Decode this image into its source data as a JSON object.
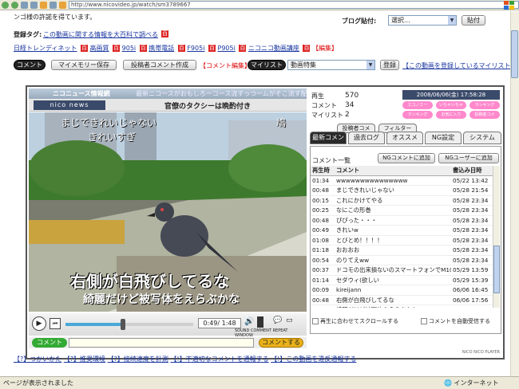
{
  "browser": {
    "address": "http://www.nicovideo.jp/watch/sm3789667",
    "top_line": "ンゴ様の許諾を得ています。",
    "status_text": "ページが表示されました",
    "zone": "インターネット"
  },
  "top": {
    "blog_label": "ブログ貼付:",
    "blog_select": "選択...",
    "blog_button": "貼付",
    "tags_label": "登録タグ:",
    "tags_link": "この動画に関する情報を大百科で調べる",
    "tags": [
      "日経トレンディネット",
      "高画質",
      "905i",
      "携帯電話",
      "F905i",
      "P905i",
      "ニコニコ動画講座",
      "【編集】"
    ],
    "comment_btn": "コメント",
    "memory_btn": "マイメモリー保存",
    "owner_btn": "投稿者コメント作成",
    "comment_edit": "【コメント編集】",
    "mylist_btn": "マイリスト",
    "mylist_select": "動画特集",
    "register_btn": "登録",
    "mylist_link": "【この動画を登録しているマイリスト】"
  },
  "player": {
    "banner_text": "ニコニュース情報網",
    "banner_scroll": "最新ニコースがおもしろーコース流すっつームがそこ流す配信中",
    "nico_news": "nico news",
    "headline": "官僚のタクシーは晩酌付き",
    "overlay1": "まじできれいじゃない",
    "overlay2": "きれいすぎ",
    "overlay3": "鳩",
    "subtitle_big": "右側が白飛びしてるな",
    "subtitle_small": "綺麗だけど被写体をえらぶかな",
    "time": "0:49/ 1:48",
    "labels": [
      "SOUND",
      "COMMENT",
      "REPEAT",
      "WINDOW"
    ],
    "comment_label": "コメント",
    "send_label": "コメントする",
    "footer_logo": "NICO NICO PLAYER",
    "progress": 0.45
  },
  "stats": {
    "play_label": "再生",
    "play_value": "570",
    "comment_label": "コメント",
    "comment_value": "34",
    "mylist_label": "マイリスト",
    "mylist_value": "2",
    "datetime": "2008/06/06(金) 17:58:28",
    "buttons": [
      "エコノミー",
      "いちゃいちゃ",
      "ランキング",
      "ランキング",
      "お気に入り",
      "投稿者コメ"
    ]
  },
  "panel": {
    "tabs_top": [
      "投稿者コメ",
      "フィルター"
    ],
    "tabs": [
      "最新コメント",
      "過去ログ",
      "オススメ",
      "NG設定",
      "システム"
    ],
    "list_title": "コメント一覧",
    "ng_comment": "NGコメントに追加",
    "ng_user": "NGユーザーに追加",
    "headers": [
      "再生時",
      "コメント",
      "書込み日時"
    ],
    "rows": [
      [
        "01:34",
        "wwwwwwwwwwwwwww",
        "05/22 13:42"
      ],
      [
        "00:48",
        "まじできれいじゃない",
        "05/28 21:54"
      ],
      [
        "00:15",
        "これにかけてやる",
        "05/28 23:34"
      ],
      [
        "00:25",
        "なにこの形巻",
        "05/28 23:34"
      ],
      [
        "00:48",
        "ぴぴった・・・",
        "05/28 23:34"
      ],
      [
        "00:49",
        "きれいw",
        "05/28 23:34"
      ],
      [
        "01:08",
        "とびとめ！！！！",
        "05/28 23:34"
      ],
      [
        "01:18",
        "おおおお",
        "05/28 23:34"
      ],
      [
        "00:54",
        "のりてえww",
        "05/28 23:34"
      ],
      [
        "00:37",
        "ドコモの出来損ないのスマートフォンでM10X",
        "05/29 13:59"
      ],
      [
        "01:14",
        "セダウィ(欲しい",
        "05/29 15:39"
      ],
      [
        "00:09",
        "kireijann",
        "06/06 16:45"
      ],
      [
        "00:48",
        "右側が白飛びしてるな",
        "06/06 17:56"
      ],
      [
        "00:48",
        "綺麗だけど被写体をえらぶかな",
        "06/06 17:57"
      ]
    ],
    "scroll_check": "再生に合わせてスクロールする",
    "auto_check": "コメントを自動受信する"
  },
  "footer": {
    "links": [
      "【?】つかいかた",
      "【?】推奨環境",
      "【?】接続速度を計測",
      "【!】不適切なコメントを通報する",
      "【!】この動画を違反通報する"
    ]
  },
  "colors": {
    "accent_red": "#dd0000",
    "link_blue": "#1a36a0",
    "player_dark": "#222222"
  }
}
